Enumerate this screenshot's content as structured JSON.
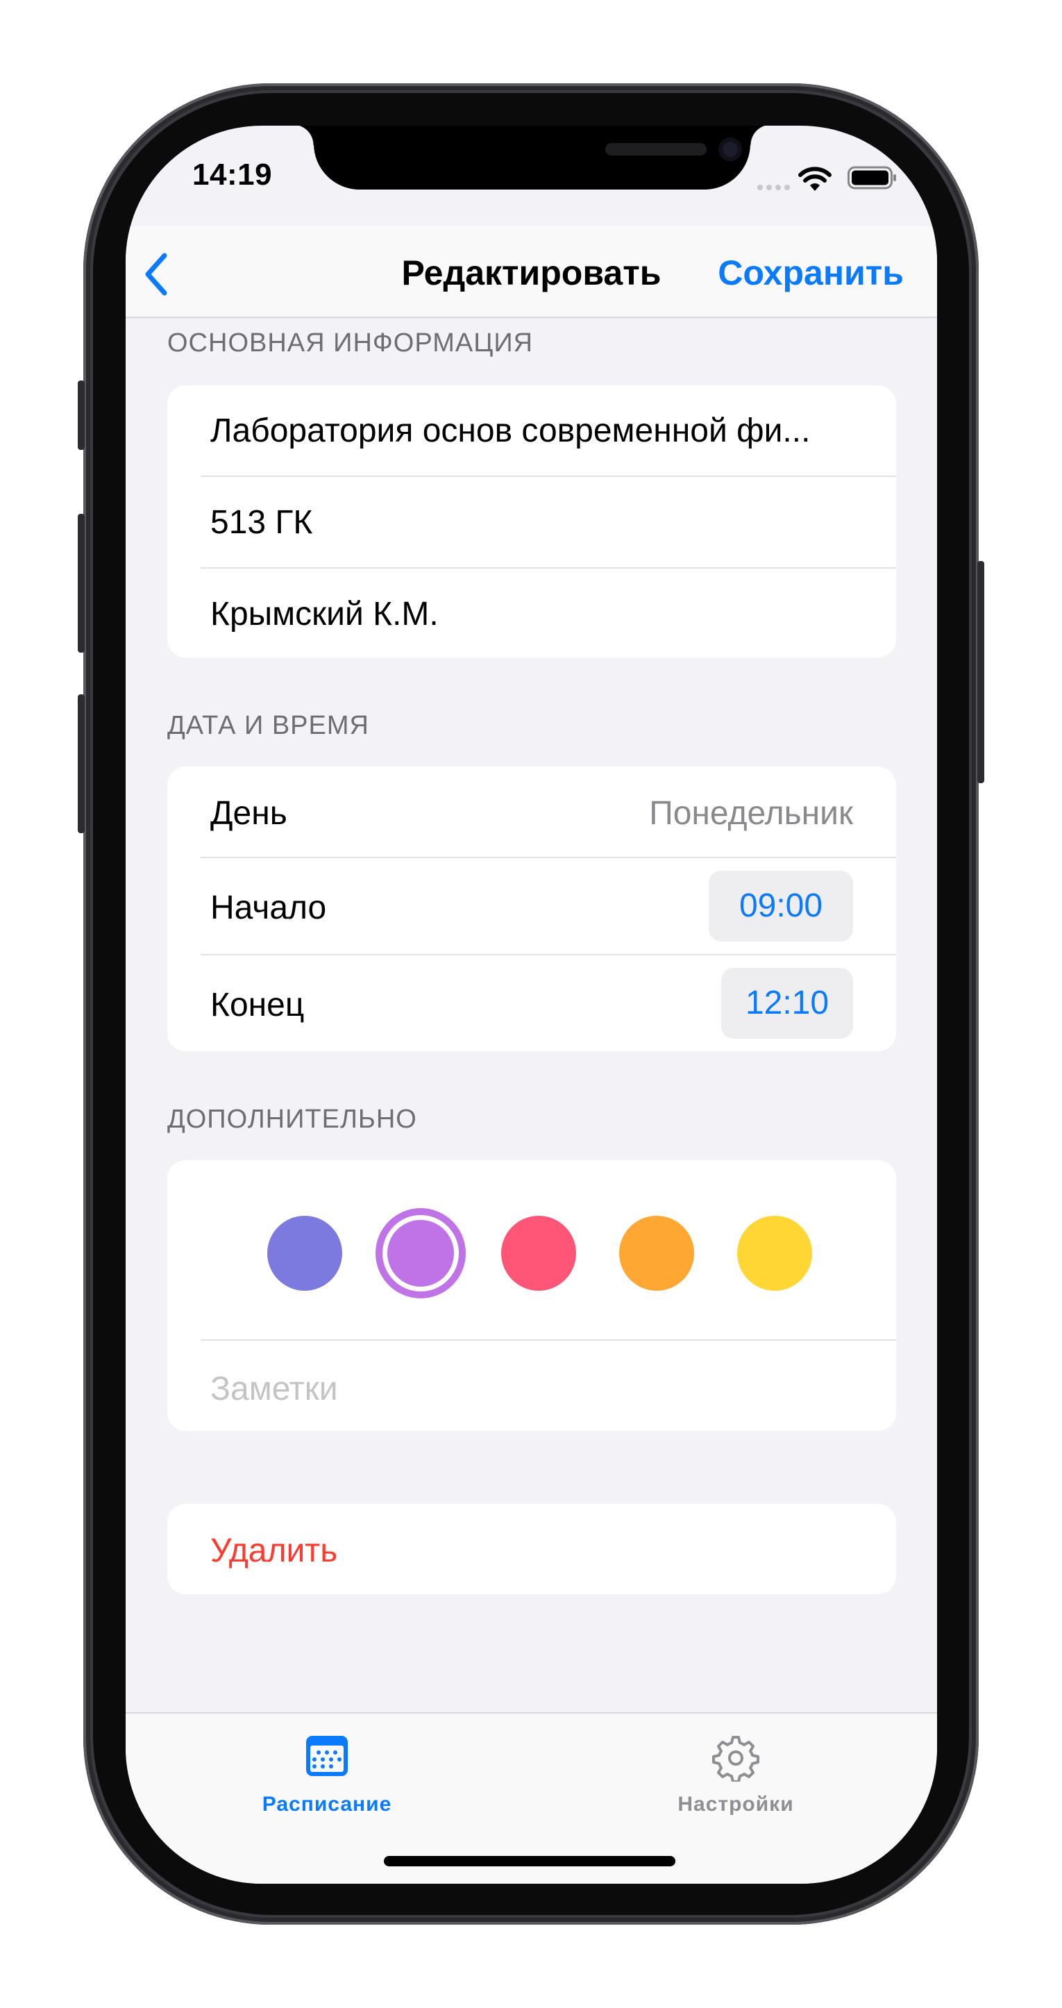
{
  "status_bar": {
    "time": "14:19"
  },
  "nav": {
    "back_icon": "chevron-left-icon",
    "title": "Редактировать",
    "save_label": "Сохранить"
  },
  "sections": {
    "basic": {
      "header": "ОСНОВНАЯ ИНФОРМАЦИЯ",
      "subject": "Лаборатория основ современной фи...",
      "room": "513 ГК",
      "teacher": "Крымский К.М."
    },
    "datetime": {
      "header": "ДАТА И ВРЕМЯ",
      "day_label": "День",
      "day_value": "Понедельник",
      "start_label": "Начало",
      "start_value": "09:00",
      "end_label": "Конец",
      "end_value": "12:10"
    },
    "extra": {
      "header": "ДОПОЛНИТЕЛЬНО",
      "colors": [
        "#7d7adf",
        "#bf73e6",
        "#ff5577",
        "#ffa733",
        "#ffd633"
      ],
      "selected_color_index": 1,
      "notes_placeholder": "Заметки"
    },
    "delete": {
      "label": "Удалить"
    }
  },
  "tabbar": {
    "tabs": [
      {
        "label": "Расписание",
        "icon": "calendar-icon",
        "active": true
      },
      {
        "label": "Настройки",
        "icon": "gear-icon",
        "active": false
      }
    ]
  },
  "theme": {
    "accent": "#0a7aff",
    "destructive": "#ff3b30",
    "background": "#f2f2f7"
  }
}
